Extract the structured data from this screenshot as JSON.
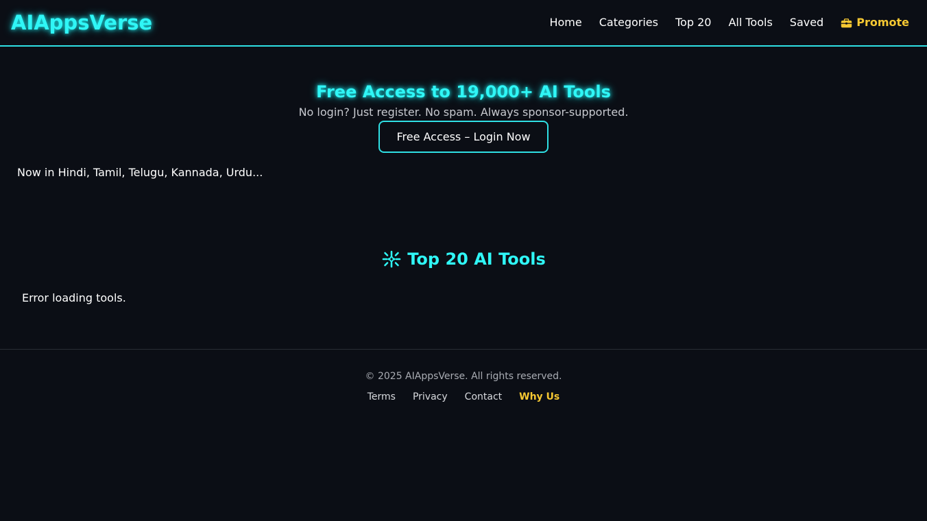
{
  "header": {
    "logo": "AIAppsVerse",
    "nav": {
      "home": "Home",
      "categories": "Categories",
      "top20": "Top 20",
      "all_tools": "All Tools",
      "saved": "Saved",
      "promote": "Promote"
    }
  },
  "hero": {
    "title": "Free Access to 19,000+ AI Tools",
    "subtitle": "No login? Just register. No spam. Always sponsor-supported.",
    "cta_label": "Free Access – Login Now"
  },
  "languages_note": "Now in Hindi, Tamil, Telugu, Kannada, Urdu...",
  "top_tools": {
    "title": "Top 20 AI Tools",
    "error": "Error loading tools."
  },
  "footer": {
    "copyright": "© 2025 AIAppsVerse. All rights reserved.",
    "links": {
      "terms": "Terms",
      "privacy": "Privacy",
      "contact": "Contact",
      "why_us": "Why Us"
    }
  },
  "colors": {
    "background": "#0b0e15",
    "accent_cyan": "#2ff6f6",
    "accent_yellow": "#f6c832"
  },
  "icons": {
    "promote": "briefcase-icon",
    "top_tools": "sparkle-icon"
  }
}
